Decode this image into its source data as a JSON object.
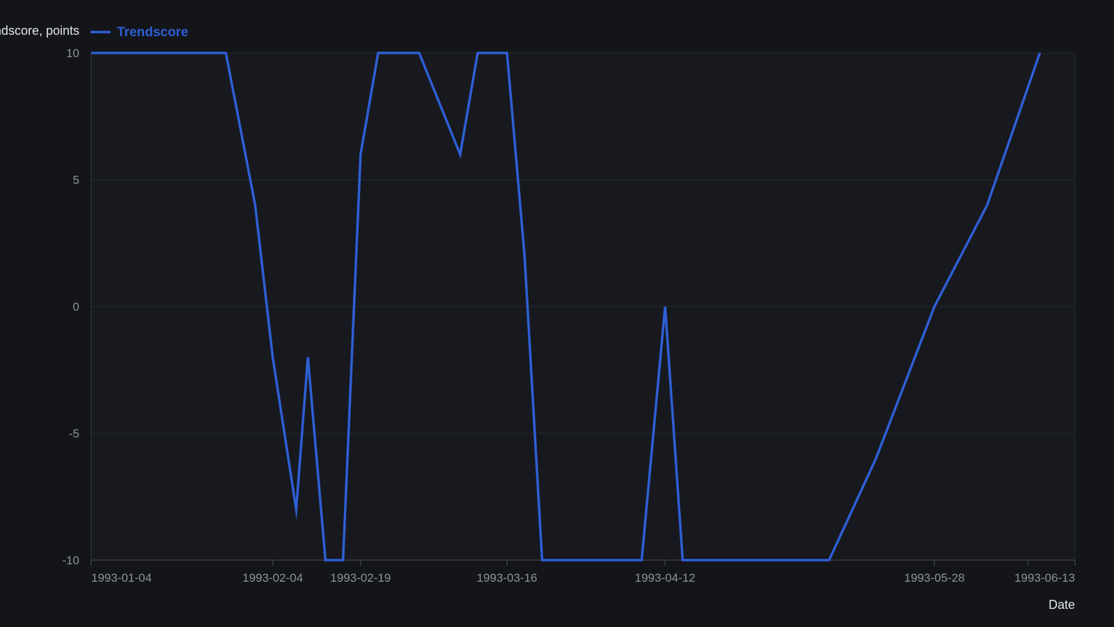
{
  "colors": {
    "background": "#131519",
    "plot_background": "#17191e",
    "grid": "#262a31",
    "axis": "#3a3e46",
    "tick_text": "#8d929b",
    "axis_title": "#e2e5ea",
    "series": "#2f5fd6"
  },
  "chart_data": {
    "type": "line",
    "title": "",
    "xlabel": "Date",
    "ylabel": "Trendscore, points",
    "x_axis_type": "date",
    "xlim": [
      "1993-01-04",
      "1993-06-21"
    ],
    "ylim": [
      -10,
      10
    ],
    "y_ticks": [
      10,
      5,
      0,
      -5,
      -10
    ],
    "y_tick_labels": [
      "10",
      "5",
      "0",
      "-5",
      "-10"
    ],
    "x_ticks": [
      "1993-01-04",
      "1993-02-04",
      "1993-02-19",
      "1993-03-16",
      "1993-04-12",
      "1993-05-28",
      "1993-06-13"
    ],
    "grid": true,
    "legend": {
      "position": "top-left",
      "entries": [
        "Trendscore"
      ]
    },
    "series": [
      {
        "name": "Trendscore",
        "x": [
          "1993-01-04",
          "1993-01-27",
          "1993-02-01",
          "1993-02-04",
          "1993-02-08",
          "1993-02-10",
          "1993-02-13",
          "1993-02-16",
          "1993-02-19",
          "1993-02-22",
          "1993-03-01",
          "1993-03-08",
          "1993-03-11",
          "1993-03-16",
          "1993-03-19",
          "1993-03-22",
          "1993-04-08",
          "1993-04-12",
          "1993-04-15",
          "1993-05-10",
          "1993-05-18",
          "1993-05-28",
          "1993-06-06",
          "1993-06-15"
        ],
        "values": [
          10,
          10,
          4,
          -2,
          -8,
          -2,
          -10,
          -10,
          6,
          10,
          10,
          6,
          10,
          10,
          2,
          -10,
          -10,
          0,
          -10,
          -10,
          -6,
          0,
          4,
          10
        ]
      }
    ]
  }
}
